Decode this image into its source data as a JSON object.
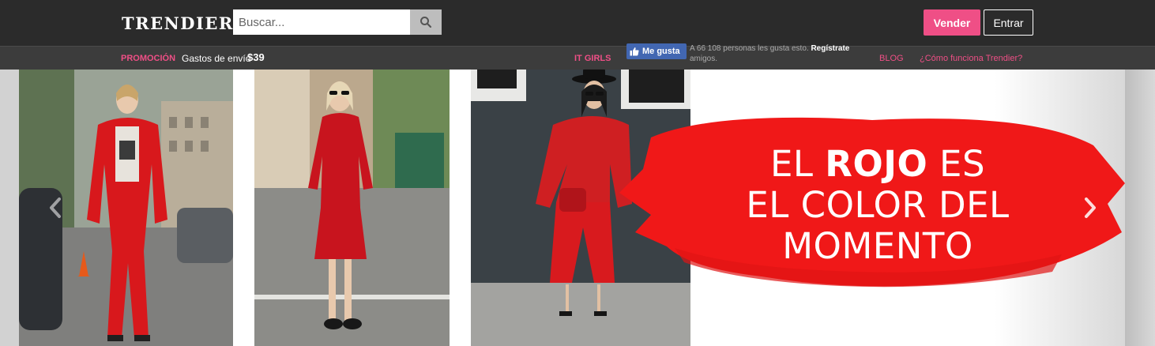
{
  "header": {
    "logo_text": "TRENDIER",
    "search": {
      "placeholder": "Buscar...",
      "value": "",
      "icon": "search-icon"
    },
    "sell_label": "Vender",
    "login_label": "Entrar"
  },
  "subbar": {
    "promo_label": "PROMOCIÓN",
    "promo_text": "Gastos de envío",
    "promo_price": "$39",
    "it_girls_label": "IT GIRLS",
    "fb_like_label": "Me gusta",
    "fb_count_text": "A 66 108 personas les gusta esto.",
    "fb_register_label": "Regístrate",
    "fb_suffix_text": "amigos.",
    "blog_label": "BLOG",
    "how_label": "¿Cómo funciona Trendier?"
  },
  "carousel": {
    "headline": {
      "line1_pre": "EL ",
      "line1_bold": "ROJO",
      "line1_post": " ES",
      "line2": "EL COLOR DEL",
      "line3": "MOMENTO"
    },
    "prev_icon": "chevron-left-icon",
    "next_icon": "chevron-right-icon"
  },
  "colors": {
    "accent": "#ef4f86",
    "header_bg": "#2b2b2b",
    "subbar_bg": "#3c3c3c",
    "brush_red": "#f01818",
    "fb_blue": "#4267b2"
  }
}
